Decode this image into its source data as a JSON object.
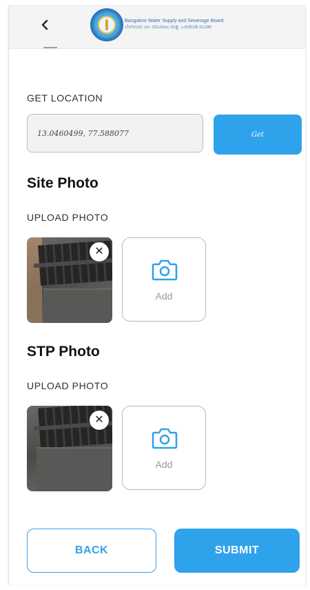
{
  "header": {
    "back_icon": "chevron-left-icon",
    "org_name_en": "Bangalore Water Supply and Sewerage Board",
    "org_name_kn": "ಬೆಂಗಳೂರು ಜಲ ಸರಬರಾಜು ಮತ್ತು ಒಳಚರಂಡಿ ಮಂಡಳಿ"
  },
  "location": {
    "label": "GET LOCATION",
    "value": "13.0460499, 77.588077",
    "get_button": "Get"
  },
  "site_photo": {
    "title": "Site Photo",
    "upload_label": "UPLOAD PHOTO",
    "remove_icon": "close-icon",
    "add_label": "Add",
    "add_icon": "camera-icon"
  },
  "stp_photo": {
    "title": "STP Photo",
    "upload_label": "UPLOAD PHOTO",
    "remove_icon": "close-icon",
    "add_label": "Add",
    "add_icon": "camera-icon"
  },
  "actions": {
    "back": "BACK",
    "submit": "SUBMIT"
  },
  "colors": {
    "accent": "#2fa2ec",
    "input_bg": "#f2f2f2",
    "header_bg": "#f4f4f4"
  }
}
